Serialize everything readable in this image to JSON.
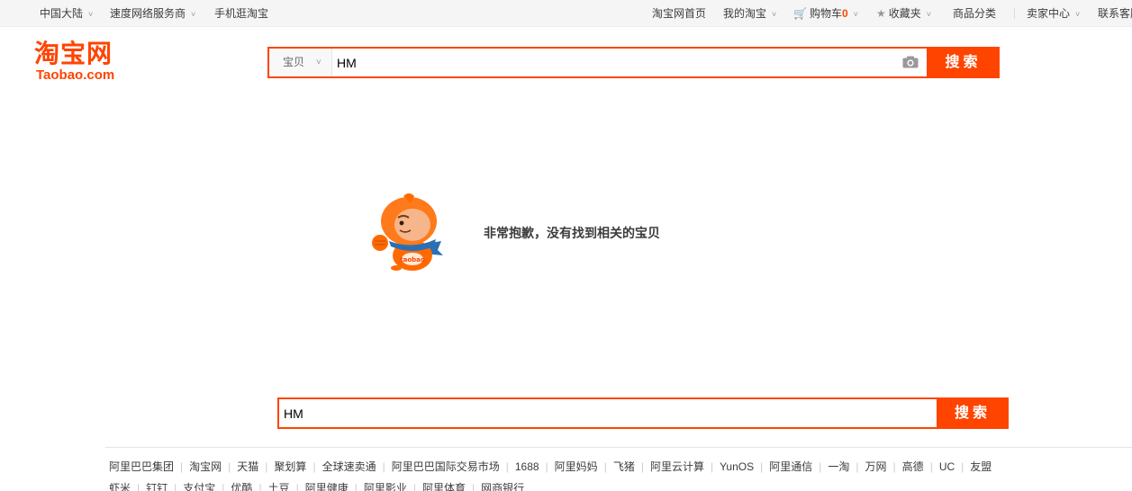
{
  "topbar": {
    "region": "中国大陆",
    "speed_isp": "速度网络服务商",
    "mobile": "手机逛淘宝",
    "home": "淘宝网首页",
    "my_taobao": "我的淘宝",
    "cart": "购物车",
    "cart_count": "0",
    "favorites": "收藏夹",
    "categories": "商品分类",
    "seller_center": "卖家中心",
    "contact": "联系客服"
  },
  "logo": {
    "cn": "淘宝网",
    "en": "Taobao.com"
  },
  "search_top": {
    "type": "宝贝",
    "value": "HM",
    "button": "搜索"
  },
  "no_result": {
    "message": "非常抱歉，没有找到相关的宝贝",
    "mascot_badge": "taobao"
  },
  "search_bottom": {
    "value": "HM",
    "button": "搜索"
  },
  "footer": {
    "row1": [
      "阿里巴巴集团",
      "淘宝网",
      "天猫",
      "聚划算",
      "全球速卖通",
      "阿里巴巴国际交易市场",
      "1688",
      "阿里妈妈",
      "飞猪",
      "阿里云计算",
      "YunOS",
      "阿里通信",
      "一淘",
      "万网",
      "高德",
      "UC",
      "友盟"
    ],
    "row2": [
      "虾米",
      "钉钉",
      "支付宝",
      "优酷",
      "土豆",
      "阿里健康",
      "阿里影业",
      "阿里体育",
      "网商银行"
    ]
  },
  "colors": {
    "brand": "#ff4400"
  }
}
